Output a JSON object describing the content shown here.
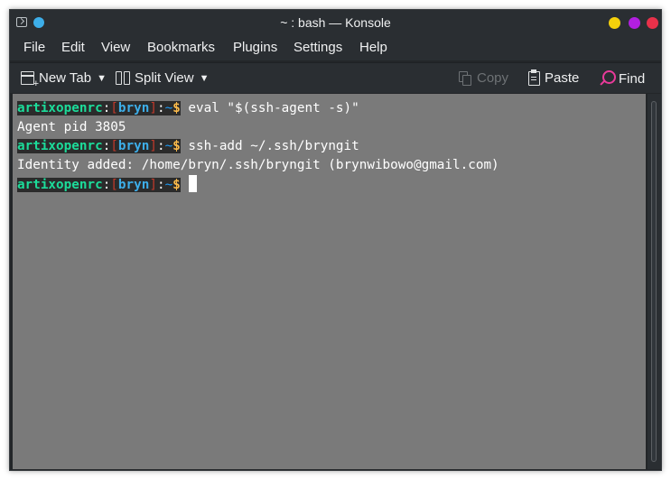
{
  "window": {
    "title": "~ : bash — Konsole"
  },
  "menu": [
    "File",
    "Edit",
    "View",
    "Bookmarks",
    "Plugins",
    "Settings",
    "Help"
  ],
  "toolbar": {
    "new_tab": "New Tab",
    "split_view": "Split View",
    "copy": "Copy",
    "paste": "Paste",
    "find": "Find"
  },
  "prompt": {
    "host": "artixopenrc",
    "colon": ":",
    "open_bracket": "[",
    "user": "bryn",
    "close_bracket": "]",
    "colon2": ":",
    "path": "~",
    "dollar": "$"
  },
  "terminal": {
    "cmd1": " eval \"$(ssh-agent -s)\"",
    "out1": "Agent pid 3805",
    "cmd2": " ssh-add ~/.ssh/bryngit",
    "out2": "Identity added: /home/bryn/.ssh/bryngit (brynwibowo@gmail.com)",
    "cmd3": " "
  },
  "colors": {
    "host": "#1cdc9a",
    "user": "#3daee9",
    "dollar": "#fdbc4b",
    "bracket": "#c0392b",
    "terminal_bg": "#7a7a7a"
  }
}
